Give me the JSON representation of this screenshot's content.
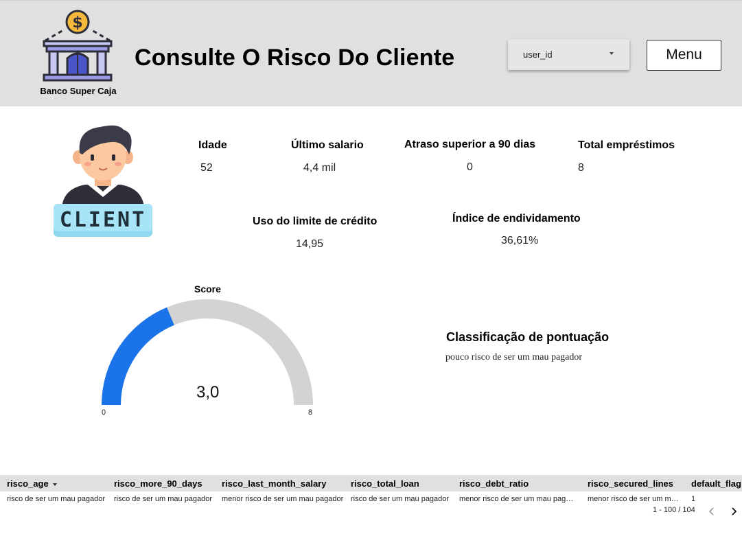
{
  "header": {
    "bank_name": "Banco Super Caja",
    "title": "Consulte O Risco Do Cliente",
    "dropdown_value": "user_id",
    "menu_label": "Menu",
    "logo_icon": "bank-building-icon",
    "background": "#e0e0e0"
  },
  "client": {
    "badge_text": "CLIENT",
    "illustration_icon": "client-avatar-icon"
  },
  "metrics": {
    "idade": {
      "label": "Idade",
      "value": "52"
    },
    "ultimo_salario": {
      "label": "Último salario",
      "value": "4,4 mil"
    },
    "atraso": {
      "label": "Atraso superior a 90 dias",
      "value": "0"
    },
    "total_emprestimos": {
      "label": "Total empréstimos",
      "value": "8"
    },
    "uso_limite": {
      "label": "Uso do limite de crédito",
      "value": "14,95"
    },
    "indice_endividamento": {
      "label": "Índice de endividamento",
      "value": "36,61%"
    }
  },
  "score": {
    "title": "Score",
    "value_label": "3,0",
    "value": 3.0,
    "min": 0,
    "max": 8,
    "min_label": "0",
    "max_label": "8",
    "fill_color": "#1a73e8",
    "track_color": "#d3d3d3"
  },
  "classification": {
    "title": "Classificação de pontuação",
    "text": "pouco risco de ser um mau pagador"
  },
  "table": {
    "columns": [
      "risco_age",
      "risco_more_90_days",
      "risco_last_month_salary",
      "risco_total_loan",
      "risco_debt_ratio",
      "risco_secured_lines",
      "default_flag"
    ],
    "row": [
      "risco de ser um mau pagador",
      "risco de ser um mau pagador",
      "menor risco de ser um mau pagador",
      "risco de ser um mau pagador",
      "menor risco de ser um mau pagador",
      "menor risco de ser um mau pagador",
      "1"
    ],
    "pagination": "1 - 100 / 104"
  }
}
